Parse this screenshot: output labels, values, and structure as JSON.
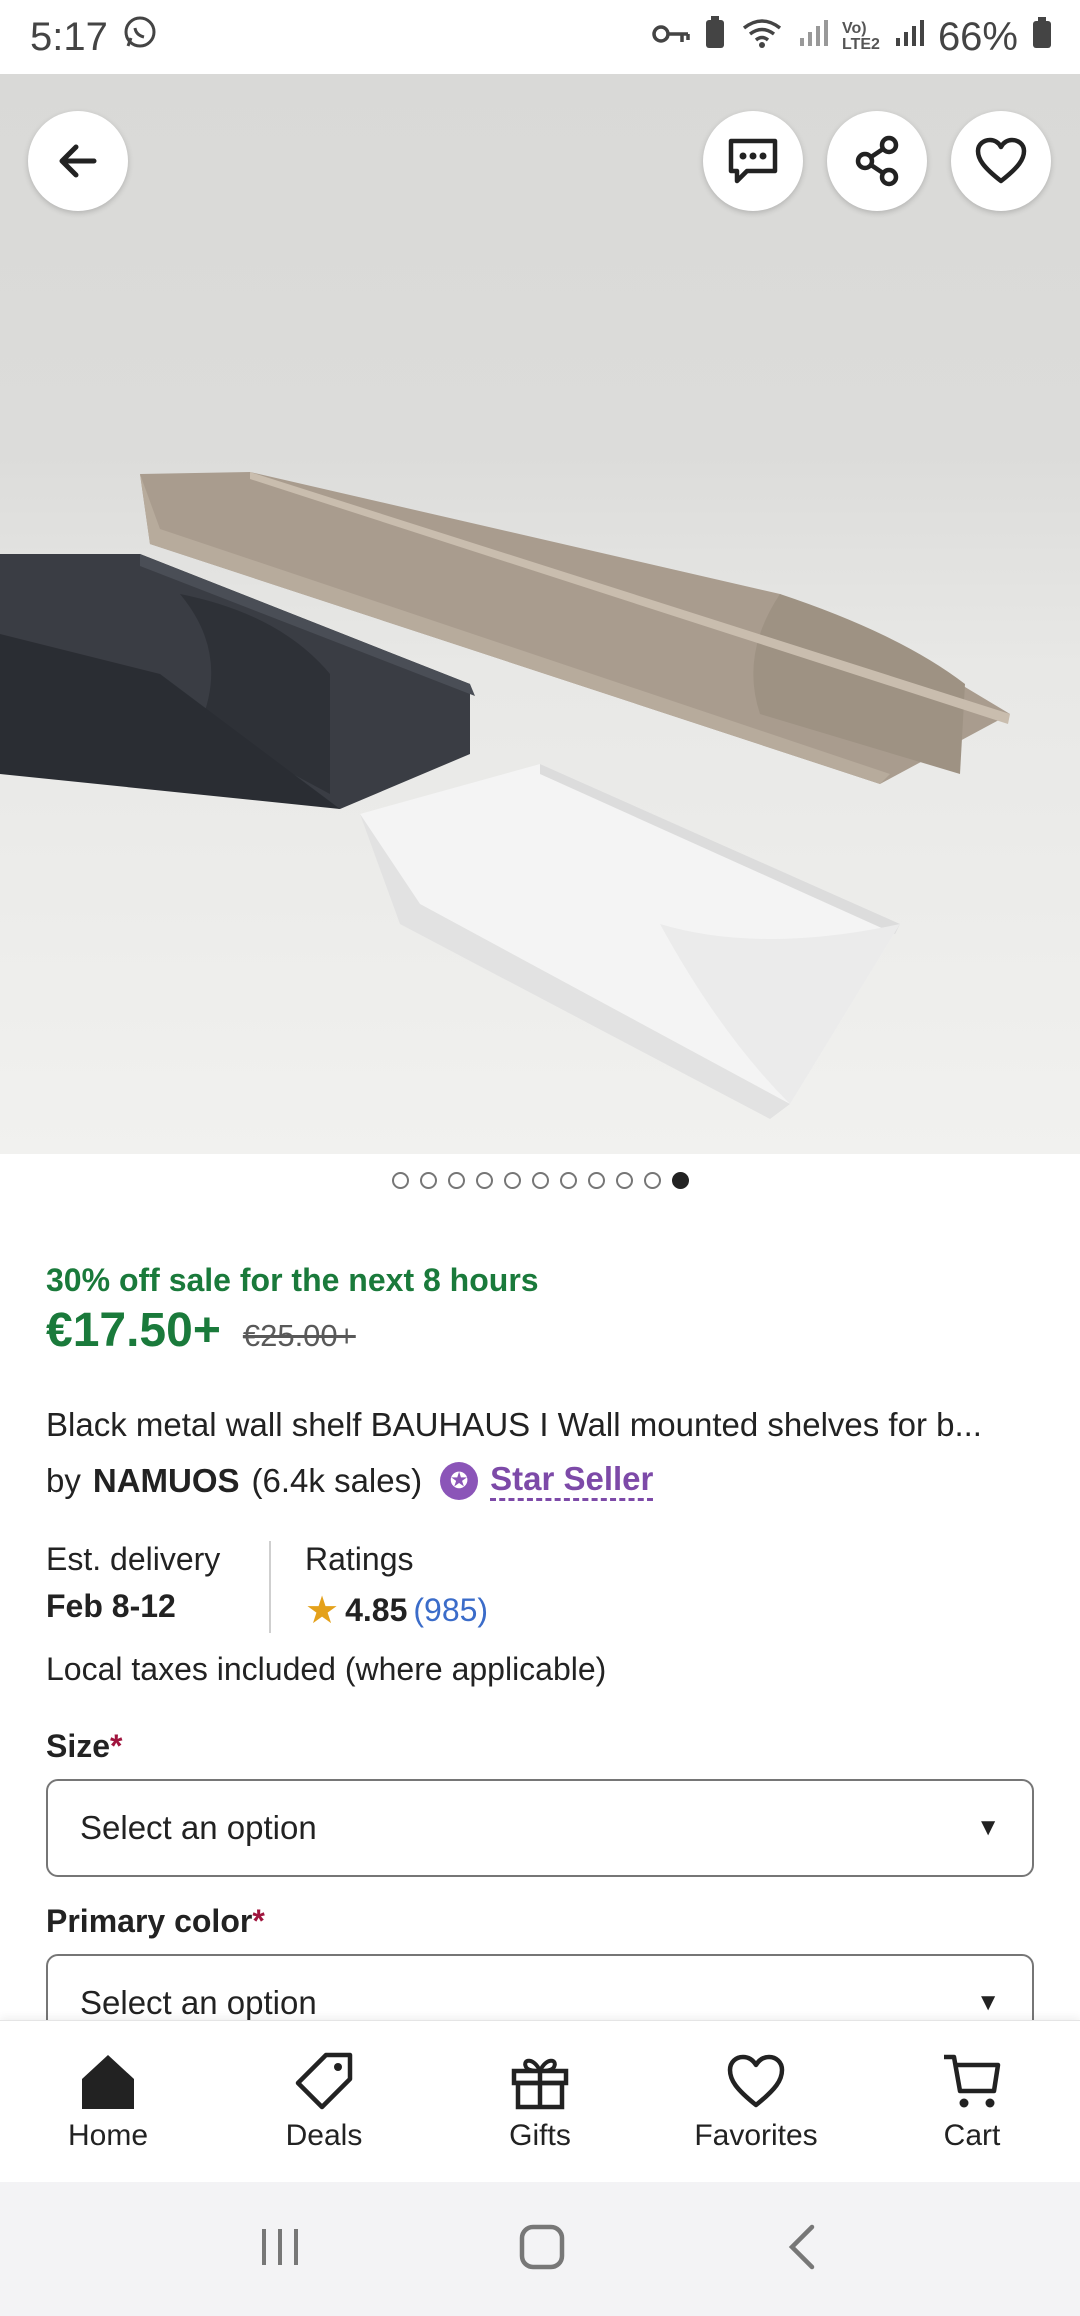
{
  "status_bar": {
    "time": "5:17",
    "battery": "66%",
    "icons": [
      "whatsapp-icon",
      "key-icon",
      "battery-saver-icon",
      "wifi-icon",
      "signal-icon",
      "volte-icon",
      "signal-icon",
      "battery-icon"
    ]
  },
  "hero": {
    "image_description_icon": "product-photo",
    "buttons": [
      "back-icon",
      "message-icon",
      "share-icon",
      "heart-icon"
    ],
    "carousel": {
      "total": 11,
      "active_index": 10
    }
  },
  "product": {
    "sale_text": "30% off sale for the next  8 hours",
    "price": "€17.50+",
    "original_price": "€25.00+",
    "title": "Black metal wall shelf BAUHAUS I  Wall mounted shelves for b...",
    "by": "by",
    "seller": "NAMUOS",
    "sales": "(6.4k sales)",
    "star_seller": "Star Seller"
  },
  "info": {
    "delivery_label": "Est. delivery",
    "delivery_value": "Feb 8-12",
    "ratings_label": "Ratings",
    "rating_value": "4.85",
    "rating_count": "(985)",
    "taxes": "Local taxes included (where applicable)"
  },
  "options": [
    {
      "label": "Size",
      "required": "*",
      "placeholder": "Select an option"
    },
    {
      "label": "Primary color",
      "required": "*",
      "placeholder": "Select an option"
    }
  ],
  "bottom_nav": [
    {
      "label": "Home",
      "icon": "home-icon"
    },
    {
      "label": "Deals",
      "icon": "tag-icon"
    },
    {
      "label": "Gifts",
      "icon": "gift-icon"
    },
    {
      "label": "Favorites",
      "icon": "heart-icon"
    },
    {
      "label": "Cart",
      "icon": "cart-icon"
    }
  ],
  "colors": {
    "sale_green": "#1a7a3b",
    "star_seller_purple": "#7d4aa8",
    "rating_star": "#e4a11b",
    "link_blue": "#3b6cc9",
    "required_red": "#a0153e"
  }
}
